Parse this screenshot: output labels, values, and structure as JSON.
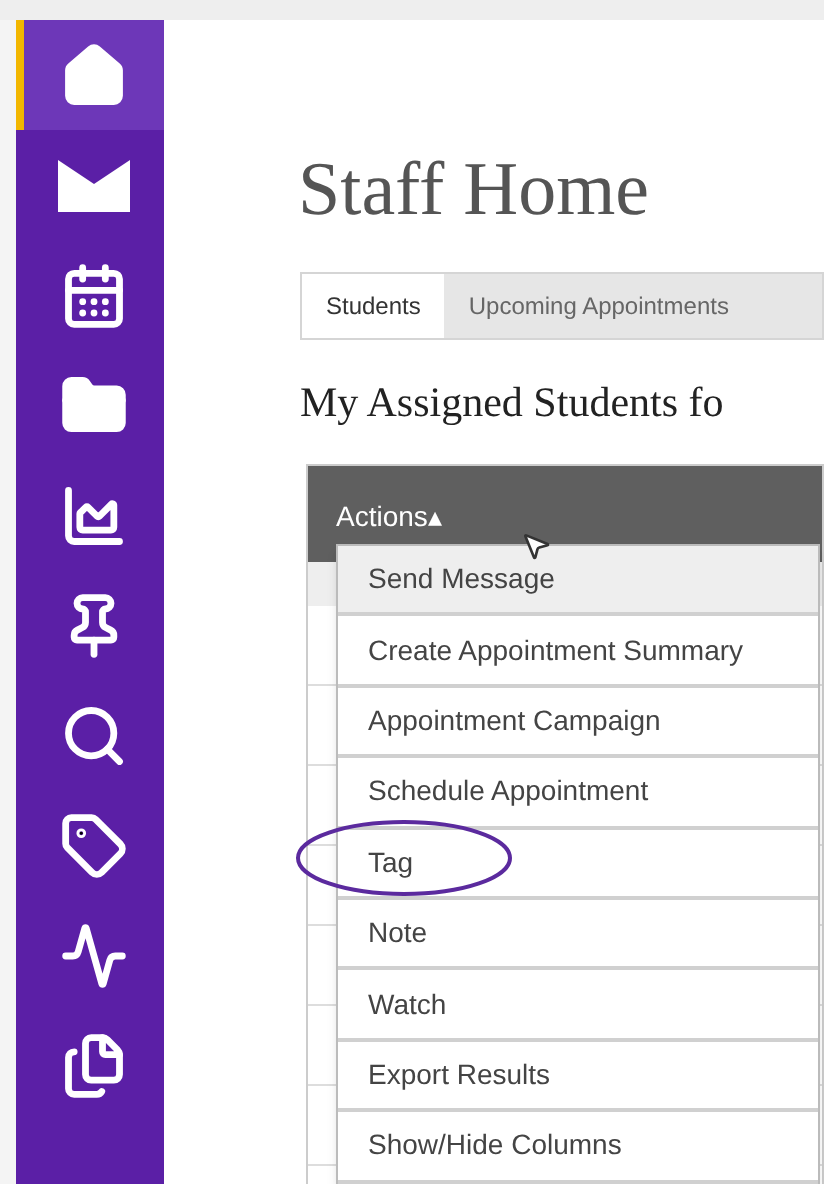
{
  "sidebar": {
    "items": [
      {
        "selected": true
      },
      {
        "selected": false
      },
      {
        "selected": false
      },
      {
        "selected": false
      },
      {
        "selected": false
      },
      {
        "selected": false
      },
      {
        "selected": false
      },
      {
        "selected": false
      },
      {
        "selected": false
      },
      {
        "selected": false
      }
    ]
  },
  "page_title": "Staff Home",
  "tabs": [
    {
      "label": "Students",
      "selected": true
    },
    {
      "label": "Upcoming Appointments",
      "selected": false
    }
  ],
  "section_title": "My Assigned Students fo",
  "table": {
    "actions_label": "Actions▴"
  },
  "actions_menu": [
    {
      "label": "Send Message",
      "highlighted": true,
      "circled": false
    },
    {
      "label": "Create Appointment Summary",
      "highlighted": false,
      "circled": false
    },
    {
      "label": "Appointment Campaign",
      "highlighted": false,
      "circled": false
    },
    {
      "label": "Schedule Appointment",
      "highlighted": false,
      "circled": false
    },
    {
      "label": "Tag",
      "highlighted": false,
      "circled": true
    },
    {
      "label": "Note",
      "highlighted": false,
      "circled": false
    },
    {
      "label": "Watch",
      "highlighted": false,
      "circled": false
    },
    {
      "label": "Export Results",
      "highlighted": false,
      "circled": false
    },
    {
      "label": "Show/Hide Columns",
      "highlighted": false,
      "circled": false
    }
  ]
}
